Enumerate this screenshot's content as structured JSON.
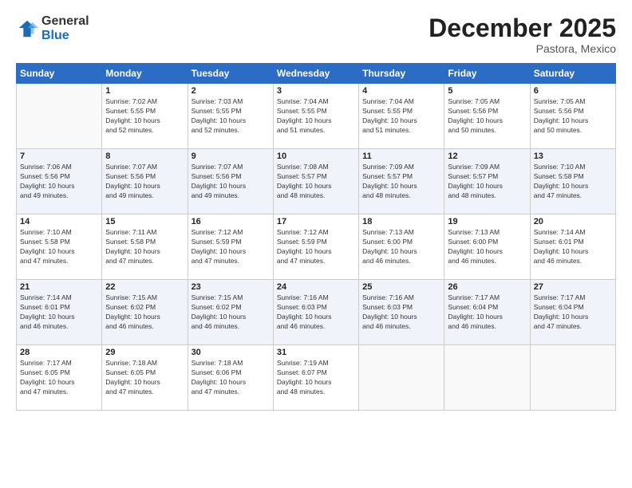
{
  "logo": {
    "general": "General",
    "blue": "Blue"
  },
  "title": "December 2025",
  "location": "Pastora, Mexico",
  "days_of_week": [
    "Sunday",
    "Monday",
    "Tuesday",
    "Wednesday",
    "Thursday",
    "Friday",
    "Saturday"
  ],
  "weeks": [
    [
      {
        "num": "",
        "info": ""
      },
      {
        "num": "1",
        "info": "Sunrise: 7:02 AM\nSunset: 5:55 PM\nDaylight: 10 hours\nand 52 minutes."
      },
      {
        "num": "2",
        "info": "Sunrise: 7:03 AM\nSunset: 5:55 PM\nDaylight: 10 hours\nand 52 minutes."
      },
      {
        "num": "3",
        "info": "Sunrise: 7:04 AM\nSunset: 5:55 PM\nDaylight: 10 hours\nand 51 minutes."
      },
      {
        "num": "4",
        "info": "Sunrise: 7:04 AM\nSunset: 5:55 PM\nDaylight: 10 hours\nand 51 minutes."
      },
      {
        "num": "5",
        "info": "Sunrise: 7:05 AM\nSunset: 5:56 PM\nDaylight: 10 hours\nand 50 minutes."
      },
      {
        "num": "6",
        "info": "Sunrise: 7:05 AM\nSunset: 5:56 PM\nDaylight: 10 hours\nand 50 minutes."
      }
    ],
    [
      {
        "num": "7",
        "info": "Sunrise: 7:06 AM\nSunset: 5:56 PM\nDaylight: 10 hours\nand 49 minutes."
      },
      {
        "num": "8",
        "info": "Sunrise: 7:07 AM\nSunset: 5:56 PM\nDaylight: 10 hours\nand 49 minutes."
      },
      {
        "num": "9",
        "info": "Sunrise: 7:07 AM\nSunset: 5:56 PM\nDaylight: 10 hours\nand 49 minutes."
      },
      {
        "num": "10",
        "info": "Sunrise: 7:08 AM\nSunset: 5:57 PM\nDaylight: 10 hours\nand 48 minutes."
      },
      {
        "num": "11",
        "info": "Sunrise: 7:09 AM\nSunset: 5:57 PM\nDaylight: 10 hours\nand 48 minutes."
      },
      {
        "num": "12",
        "info": "Sunrise: 7:09 AM\nSunset: 5:57 PM\nDaylight: 10 hours\nand 48 minutes."
      },
      {
        "num": "13",
        "info": "Sunrise: 7:10 AM\nSunset: 5:58 PM\nDaylight: 10 hours\nand 47 minutes."
      }
    ],
    [
      {
        "num": "14",
        "info": "Sunrise: 7:10 AM\nSunset: 5:58 PM\nDaylight: 10 hours\nand 47 minutes."
      },
      {
        "num": "15",
        "info": "Sunrise: 7:11 AM\nSunset: 5:58 PM\nDaylight: 10 hours\nand 47 minutes."
      },
      {
        "num": "16",
        "info": "Sunrise: 7:12 AM\nSunset: 5:59 PM\nDaylight: 10 hours\nand 47 minutes."
      },
      {
        "num": "17",
        "info": "Sunrise: 7:12 AM\nSunset: 5:59 PM\nDaylight: 10 hours\nand 47 minutes."
      },
      {
        "num": "18",
        "info": "Sunrise: 7:13 AM\nSunset: 6:00 PM\nDaylight: 10 hours\nand 46 minutes."
      },
      {
        "num": "19",
        "info": "Sunrise: 7:13 AM\nSunset: 6:00 PM\nDaylight: 10 hours\nand 46 minutes."
      },
      {
        "num": "20",
        "info": "Sunrise: 7:14 AM\nSunset: 6:01 PM\nDaylight: 10 hours\nand 46 minutes."
      }
    ],
    [
      {
        "num": "21",
        "info": "Sunrise: 7:14 AM\nSunset: 6:01 PM\nDaylight: 10 hours\nand 46 minutes."
      },
      {
        "num": "22",
        "info": "Sunrise: 7:15 AM\nSunset: 6:02 PM\nDaylight: 10 hours\nand 46 minutes."
      },
      {
        "num": "23",
        "info": "Sunrise: 7:15 AM\nSunset: 6:02 PM\nDaylight: 10 hours\nand 46 minutes."
      },
      {
        "num": "24",
        "info": "Sunrise: 7:16 AM\nSunset: 6:03 PM\nDaylight: 10 hours\nand 46 minutes."
      },
      {
        "num": "25",
        "info": "Sunrise: 7:16 AM\nSunset: 6:03 PM\nDaylight: 10 hours\nand 46 minutes."
      },
      {
        "num": "26",
        "info": "Sunrise: 7:17 AM\nSunset: 6:04 PM\nDaylight: 10 hours\nand 46 minutes."
      },
      {
        "num": "27",
        "info": "Sunrise: 7:17 AM\nSunset: 6:04 PM\nDaylight: 10 hours\nand 47 minutes."
      }
    ],
    [
      {
        "num": "28",
        "info": "Sunrise: 7:17 AM\nSunset: 6:05 PM\nDaylight: 10 hours\nand 47 minutes."
      },
      {
        "num": "29",
        "info": "Sunrise: 7:18 AM\nSunset: 6:05 PM\nDaylight: 10 hours\nand 47 minutes."
      },
      {
        "num": "30",
        "info": "Sunrise: 7:18 AM\nSunset: 6:06 PM\nDaylight: 10 hours\nand 47 minutes."
      },
      {
        "num": "31",
        "info": "Sunrise: 7:19 AM\nSunset: 6:07 PM\nDaylight: 10 hours\nand 48 minutes."
      },
      {
        "num": "",
        "info": ""
      },
      {
        "num": "",
        "info": ""
      },
      {
        "num": "",
        "info": ""
      }
    ]
  ]
}
